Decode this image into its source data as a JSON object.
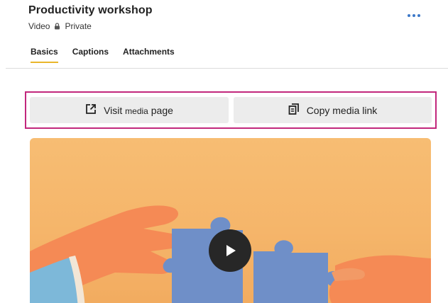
{
  "header": {
    "title": "Productivity workshop",
    "type_label": "Video",
    "privacy_label": "Private"
  },
  "tabs": [
    {
      "label": "Basics",
      "active": true
    },
    {
      "label": "Captions",
      "active": false
    },
    {
      "label": "Attachments",
      "active": false
    }
  ],
  "actions": {
    "visit_prefix": "Visit",
    "visit_mid": "media",
    "visit_suffix": "page",
    "copy_label": "Copy media link"
  },
  "colors": {
    "accent_tab": "#e9b62b",
    "highlight_frame": "#c2277c",
    "more_dots": "#3c78c8"
  },
  "icons": {
    "lock": "lock-icon",
    "more": "more-horizontal-icon",
    "external": "external-link-icon",
    "copy": "copy-icon",
    "play": "play-icon"
  }
}
